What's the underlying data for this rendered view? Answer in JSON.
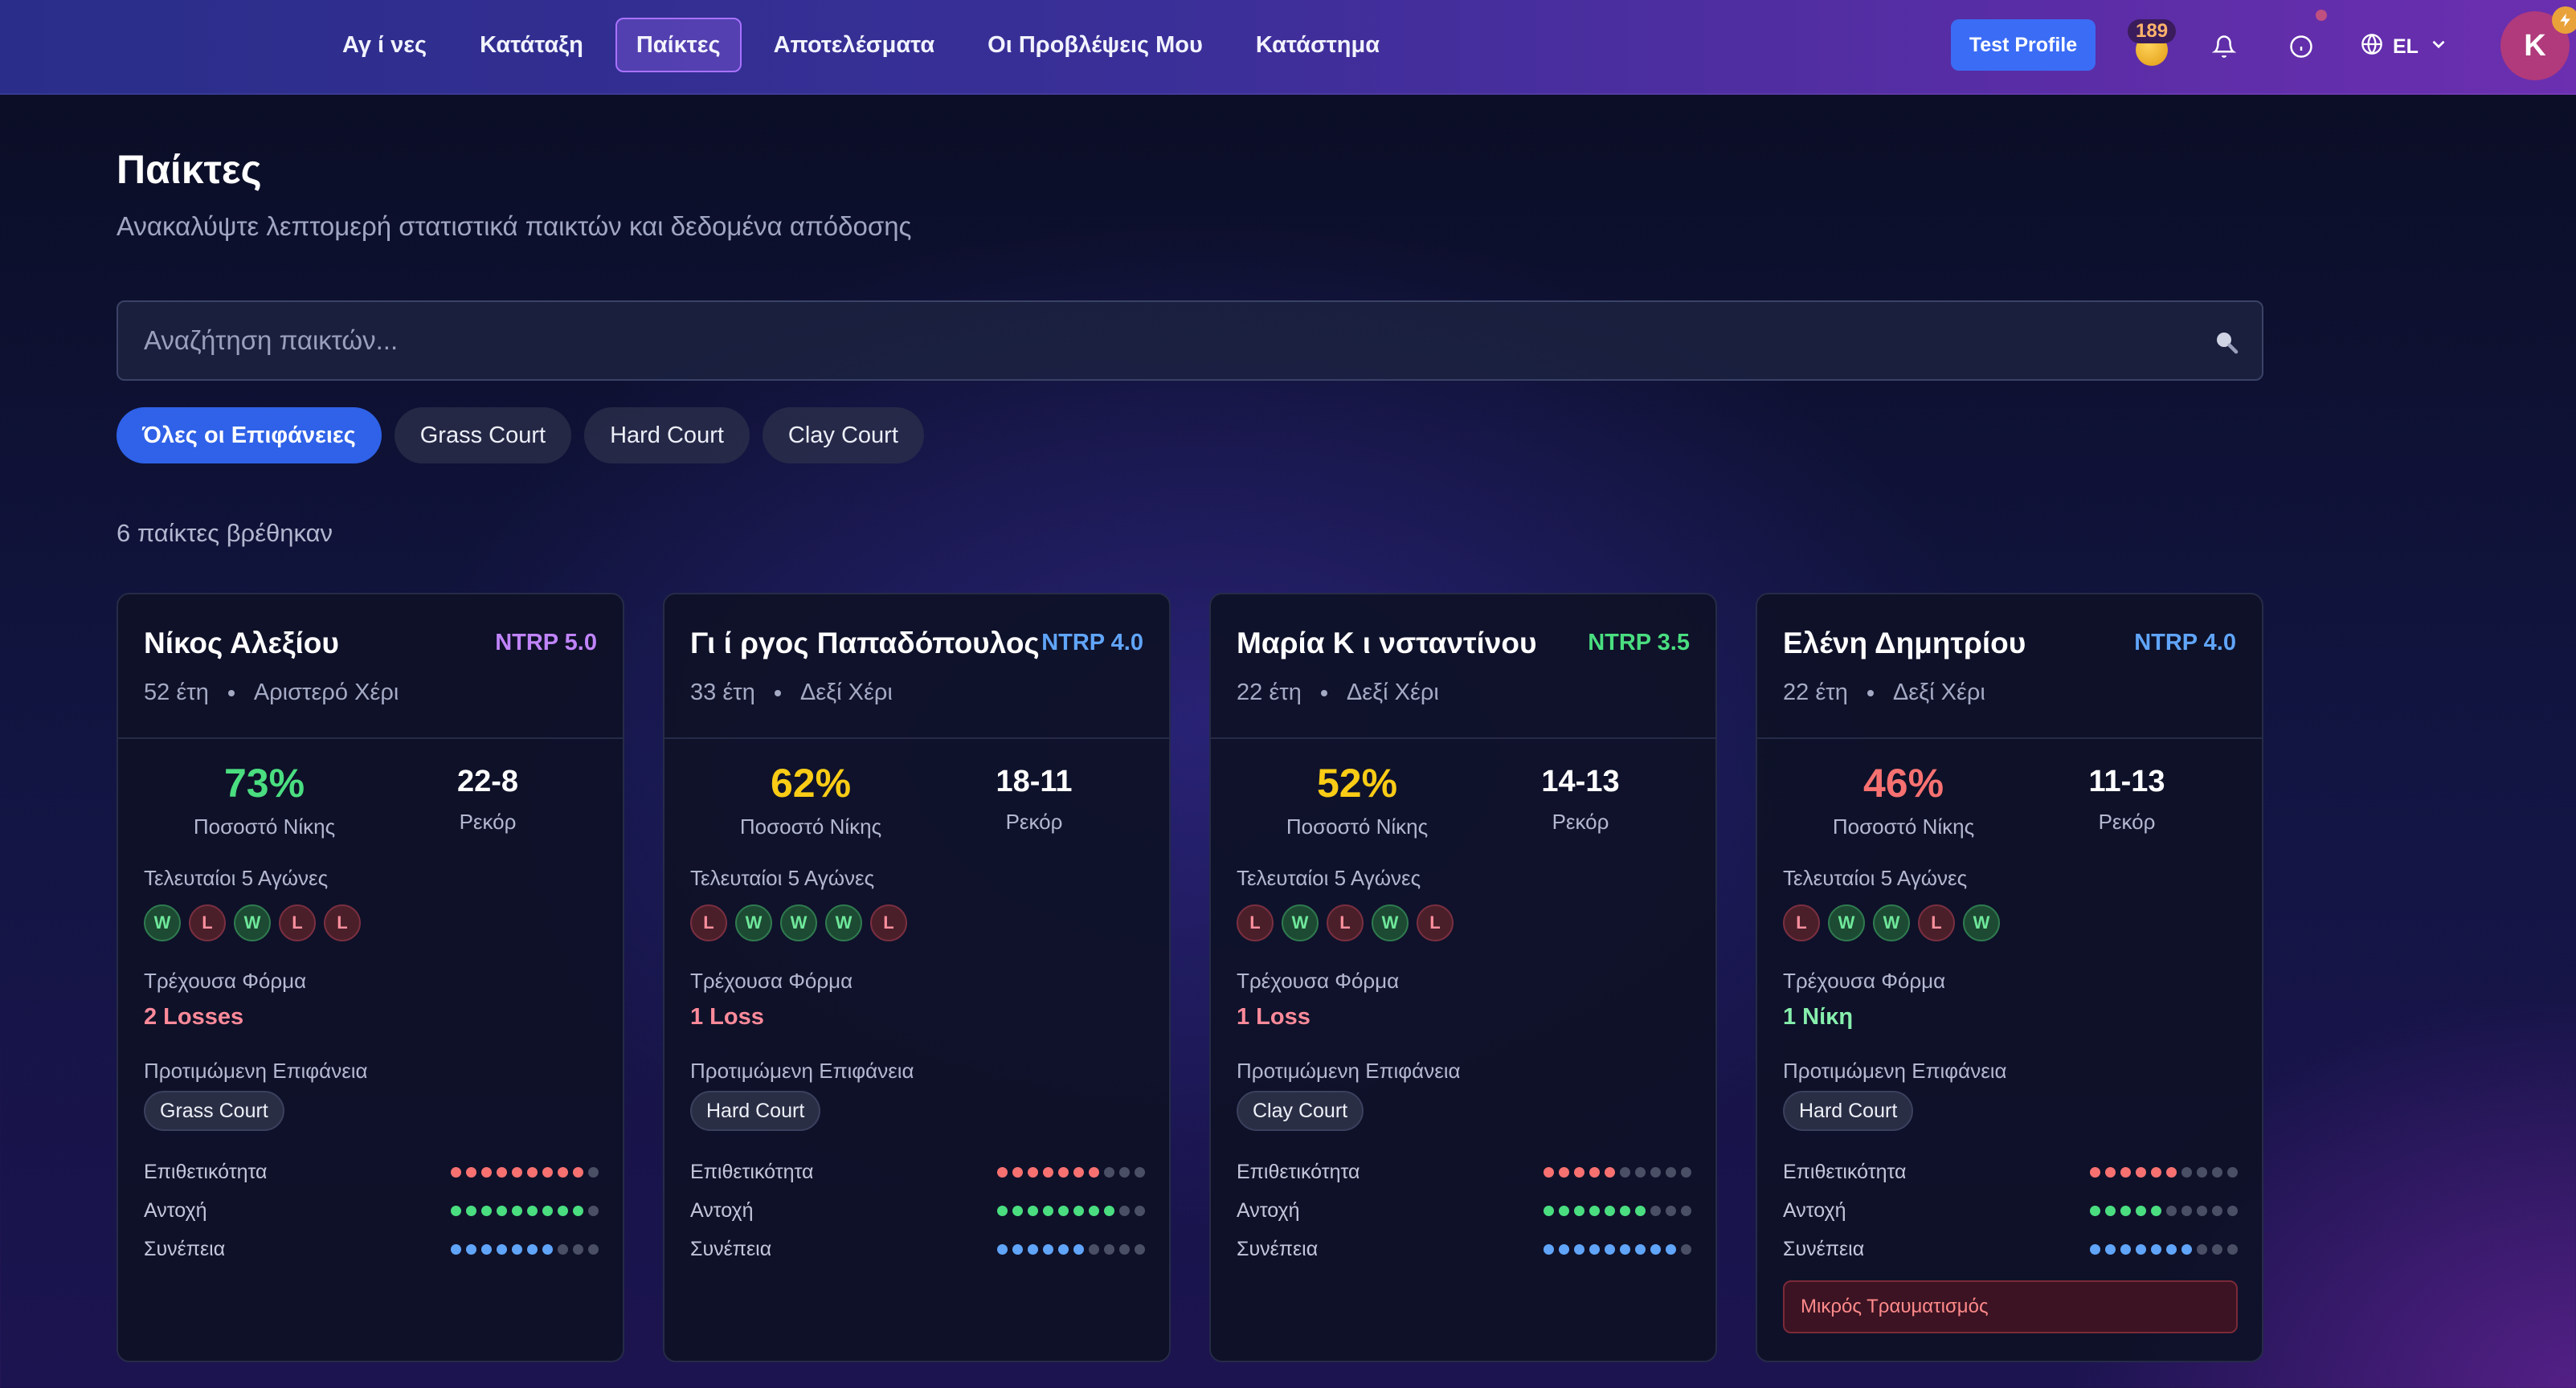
{
  "nav": {
    "links": [
      "Αγ ί νες",
      "Κατάταξη",
      "Παίκτες",
      "Αποτελέσματα",
      "Οι Προβλέψεις Μου",
      "Κατάστημα"
    ],
    "active_index": 2,
    "test_profile": "Test Profile",
    "coins": "189",
    "language": "EL",
    "avatar_initial": "K",
    "icons": [
      "coin-icon",
      "bell-icon",
      "info-icon",
      "globe-icon",
      "chevron-down-icon"
    ]
  },
  "page": {
    "title": "Παίκτες",
    "subtitle": "Ανακαλύψτε λεπτομερή στατιστικά παικτών και δεδομένα απόδοσης",
    "search_placeholder": "Αναζήτηση παικτών...",
    "filters": [
      "Όλες οι Επιφάνειες",
      "Grass Court",
      "Hard Court",
      "Clay Court"
    ],
    "active_filter": 0,
    "count_text": "6 παίκτες βρέθηκαν"
  },
  "labels": {
    "win_pct": "Ποσοστό Νίκης",
    "record": "Ρεκόρ",
    "last5": "Τελευταίοι 5 Αγώνες",
    "form": "Τρέχουσα Φόρμα",
    "preferred_surface": "Προτιμώμενη Επιφάνεια",
    "aggression": "Επιθετικότητα",
    "endurance": "Αντοχή",
    "consistency": "Συνέπεια"
  },
  "colors": {
    "green": "#4ade80",
    "yellow": "#facc15",
    "red": "#f87171",
    "purple": "#c084fc",
    "blue": "#60a5fa",
    "stat_red": "#f87171",
    "stat_green": "#4ade80",
    "stat_blue": "#60a5fa"
  },
  "players": [
    {
      "name": "Νίκος Αλεξίου",
      "ntrp": "NTRP 5.0",
      "ntrp_color": "#c084fc",
      "age": "52 έτη",
      "hand": "Αριστερό Χέρι",
      "win_pct": "73%",
      "win_color": "#4ade80",
      "record": "22-8",
      "last5": [
        "W",
        "L",
        "W",
        "L",
        "L"
      ],
      "form": "2 Losses",
      "form_color": "#ff8a9a",
      "surface": "Grass Court",
      "aggression": 9,
      "endurance": 9,
      "consistency": 7,
      "injury": ""
    },
    {
      "name": "Γι ί ργος Παπαδόπουλος",
      "ntrp": "NTRP 4.0",
      "ntrp_color": "#60a5fa",
      "age": "33 έτη",
      "hand": "Δεξί Χέρι",
      "win_pct": "62%",
      "win_color": "#facc15",
      "record": "18-11",
      "last5": [
        "L",
        "W",
        "W",
        "W",
        "L"
      ],
      "form": "1 Loss",
      "form_color": "#ff8a9a",
      "surface": "Hard Court",
      "aggression": 7,
      "endurance": 8,
      "consistency": 6,
      "injury": ""
    },
    {
      "name": "Μαρία Κ ι νσταντίνου",
      "ntrp": "NTRP 3.5",
      "ntrp_color": "#4ade80",
      "age": "22 έτη",
      "hand": "Δεξί Χέρι",
      "win_pct": "52%",
      "win_color": "#facc15",
      "record": "14-13",
      "last5": [
        "L",
        "W",
        "L",
        "W",
        "L"
      ],
      "form": "1 Loss",
      "form_color": "#ff8a9a",
      "surface": "Clay Court",
      "aggression": 5,
      "endurance": 7,
      "consistency": 9,
      "injury": ""
    },
    {
      "name": "Ελένη Δημητρίου",
      "ntrp": "NTRP 4.0",
      "ntrp_color": "#60a5fa",
      "age": "22 έτη",
      "hand": "Δεξί Χέρι",
      "win_pct": "46%",
      "win_color": "#f87171",
      "record": "11-13",
      "last5": [
        "L",
        "W",
        "W",
        "L",
        "W"
      ],
      "form": "1 Νίκη",
      "form_color": "#86efac",
      "surface": "Hard Court",
      "aggression": 6,
      "endurance": 5,
      "consistency": 7,
      "injury": "Μικρός Τραυματισμός"
    }
  ]
}
